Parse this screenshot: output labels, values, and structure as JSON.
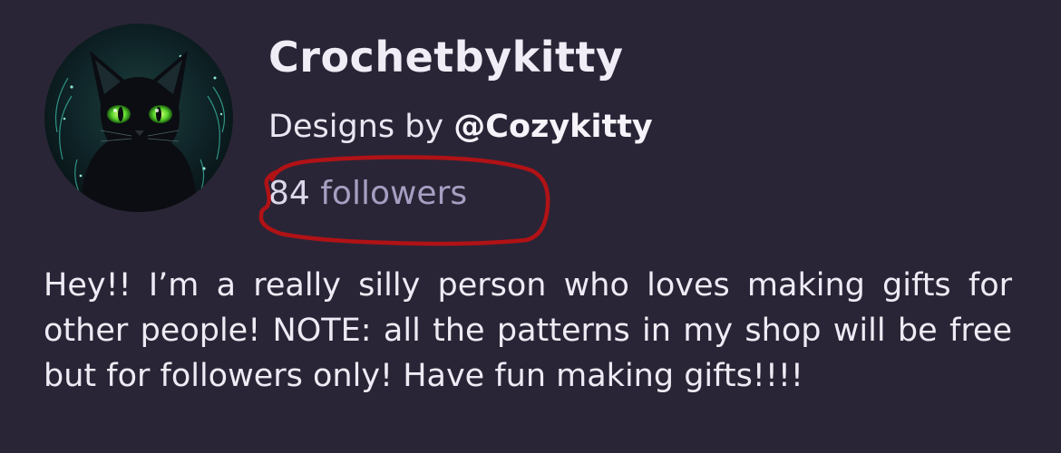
{
  "profile": {
    "name": "Crochetbykitty",
    "byline_prefix": "Designs by ",
    "byline_handle": "@Cozykitty",
    "followers_count": "84",
    "followers_label": " followers",
    "bio": "Hey!! I’m a really silly person who loves making gifts for other people! NOTE: all the patterns in my shop will be free but for followers only! Have fun making gifts!!!!"
  },
  "avatar": {
    "subject": "black-cat-portrait"
  },
  "annotation": {
    "mark": "hand-drawn-red-circle",
    "color": "#b11216"
  },
  "colors": {
    "background": "#2a2536",
    "muted_text": "#a79fc2"
  }
}
